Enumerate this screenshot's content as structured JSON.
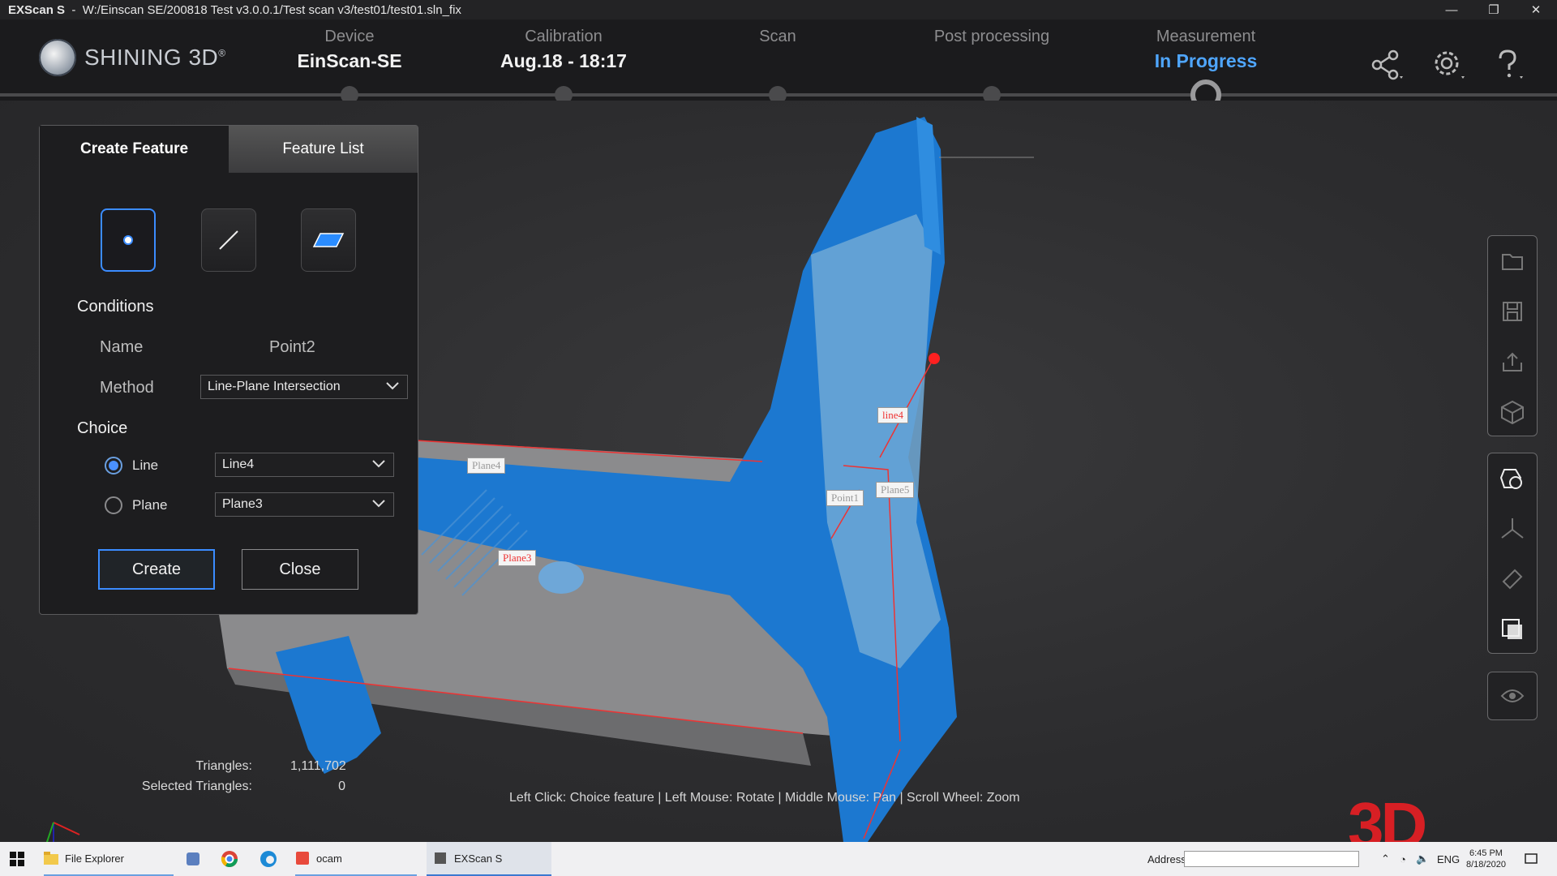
{
  "window": {
    "app": "EXScan S",
    "path": "W:/Einscan SE/200818 Test v3.0.0.1/Test scan v3/test01/test01.sln_fix",
    "minimize": "—",
    "restore": "❐",
    "close": "✕"
  },
  "logo": {
    "text": "SHINING 3D",
    "reg": "®"
  },
  "steps": [
    {
      "label": "Device",
      "value": "EinScan-SE"
    },
    {
      "label": "Calibration",
      "value": "Aug.18 - 18:17"
    },
    {
      "label": "Scan",
      "value": ""
    },
    {
      "label": "Post processing",
      "value": ""
    },
    {
      "label": "Measurement",
      "value": "In Progress"
    }
  ],
  "active_step": 4,
  "header_icons": [
    "share-icon",
    "settings-icon",
    "help-icon"
  ],
  "panel": {
    "tabs": [
      "Create Feature",
      "Feature List"
    ],
    "feature_types": [
      "point-icon",
      "line-icon",
      "plane-icon"
    ],
    "conditions_title": "Conditions",
    "name_label": "Name",
    "name_value": "Point2",
    "method_label": "Method",
    "method_value": "Line-Plane Intersection",
    "choice_title": "Choice",
    "choices": [
      {
        "label": "Line",
        "value": "Line4",
        "selected": true
      },
      {
        "label": "Plane",
        "value": "Plane3",
        "selected": false
      }
    ],
    "create_label": "Create",
    "close_label": "Close"
  },
  "scene_labels": {
    "plane4": "Plane4",
    "plane3": "Plane3",
    "line4": "line4",
    "point1": "Point1",
    "plane5": "Plane5"
  },
  "right_toolbar": [
    "folder-icon",
    "save-icon",
    "export-icon",
    "cube-icon",
    "feature-icon",
    "axis-icon",
    "measure-icon",
    "view-cube-icon",
    "eye-icon"
  ],
  "stats": {
    "triangles_label": "Triangles:",
    "triangles_value": "1,111,702",
    "selected_label": "Selected Triangles:",
    "selected_value": "0"
  },
  "hint": "Left Click: Choice feature | Left Mouse: Rotate | Middle Mouse: Pan | Scroll Wheel: Zoom",
  "watermark": "3D",
  "taskbar": {
    "items": [
      {
        "label": "File Explorer"
      },
      {
        "label": "ocam"
      },
      {
        "label": "EXScan S"
      }
    ],
    "address_label": "Address",
    "lang": "ENG",
    "time": "6:45 PM",
    "date": "8/18/2020"
  },
  "colors": {
    "accent": "#3b8cff",
    "model_blue": "#1a7ad0",
    "progress_blue": "#4fa6ff"
  }
}
